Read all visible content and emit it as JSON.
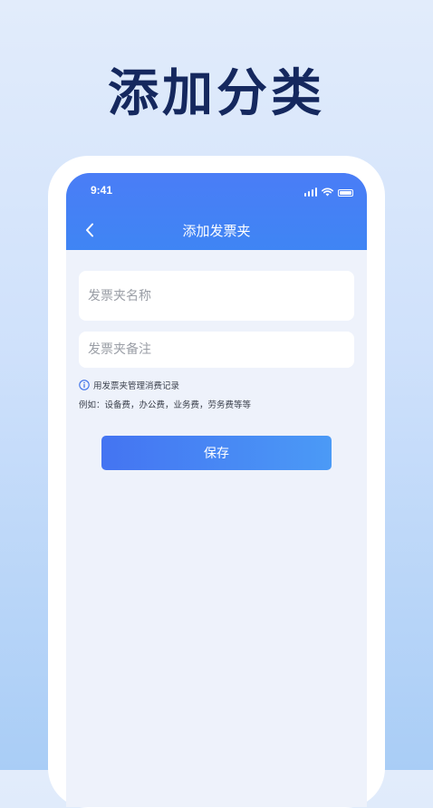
{
  "promo": {
    "title": "添加分类"
  },
  "status_bar": {
    "time": "9:41"
  },
  "nav": {
    "title": "添加发票夹"
  },
  "form": {
    "name_placeholder": "发票夹名称",
    "name_value": "",
    "note_placeholder": "发票夹备注",
    "note_value": ""
  },
  "hint": {
    "text": "用发票夹管理消费记录",
    "example": "例如：设备费，办公费，业务费，劳务费等等"
  },
  "actions": {
    "save_label": "保存"
  },
  "colors": {
    "header": "#4a7df6",
    "title": "#15285e",
    "button": "#4474f2"
  }
}
